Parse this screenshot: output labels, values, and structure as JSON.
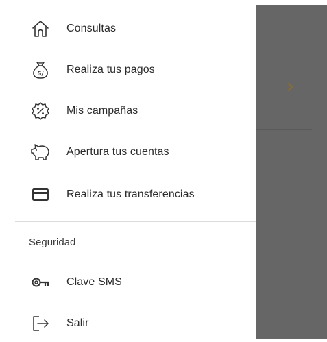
{
  "drawer": {
    "items": [
      {
        "label": "Consultas",
        "icon": "home-icon"
      },
      {
        "label": "Realiza tus pagos",
        "icon": "money-bag-icon"
      },
      {
        "label": "Mis campañas",
        "icon": "discount-badge-icon"
      },
      {
        "label": "Apertura tus cuentas",
        "icon": "piggy-bank-icon"
      },
      {
        "label": "Realiza tus transferencias",
        "icon": "credit-card-icon"
      }
    ],
    "section_title": "Seguridad",
    "security_items": [
      {
        "label": "Clave SMS",
        "icon": "key-icon"
      },
      {
        "label": "Salir",
        "icon": "logout-icon"
      }
    ]
  },
  "backdrop": {
    "chevron_icon": "chevron-right-icon",
    "overlay_color": "#666666",
    "accent_color": "#8a6d2e"
  }
}
